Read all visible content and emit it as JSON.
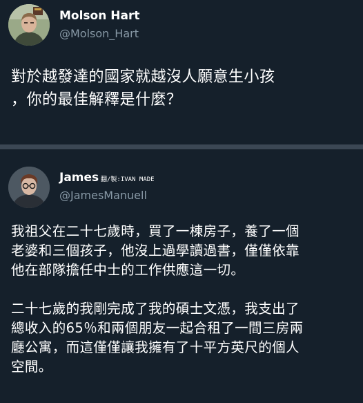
{
  "tweets": [
    {
      "display_name": "Molson Hart",
      "handle": "@Molson_Hart",
      "text_lines": [
        "對於越發達的國家就越沒人願意生小孩",
        "，你的最佳解釋是什麼？"
      ]
    },
    {
      "display_name": "James",
      "handle": "@JamesManuell",
      "credit": "翻/製:IVAN MADE",
      "paragraphs": [
        [
          "我祖父在二十七歲時，買了一棟房子，養了一個",
          "老婆和三個孩子，他沒上過學讀過書，僅僅依靠",
          "他在部隊擔任中士的工作供應這一切。"
        ],
        [
          "二十七歲的我剛完成了我的碩士文憑，我支出了",
          "總收入的65％和兩個朋友一起合租了一間三房兩",
          "廳公寓，而這僅僅讓我擁有了十平方英尺的個人",
          "空間。"
        ]
      ]
    }
  ],
  "colors": {
    "background": "#15202b",
    "divider": "#3b4754",
    "secondary_text": "#8899a6",
    "primary_text": "#ffffff"
  }
}
